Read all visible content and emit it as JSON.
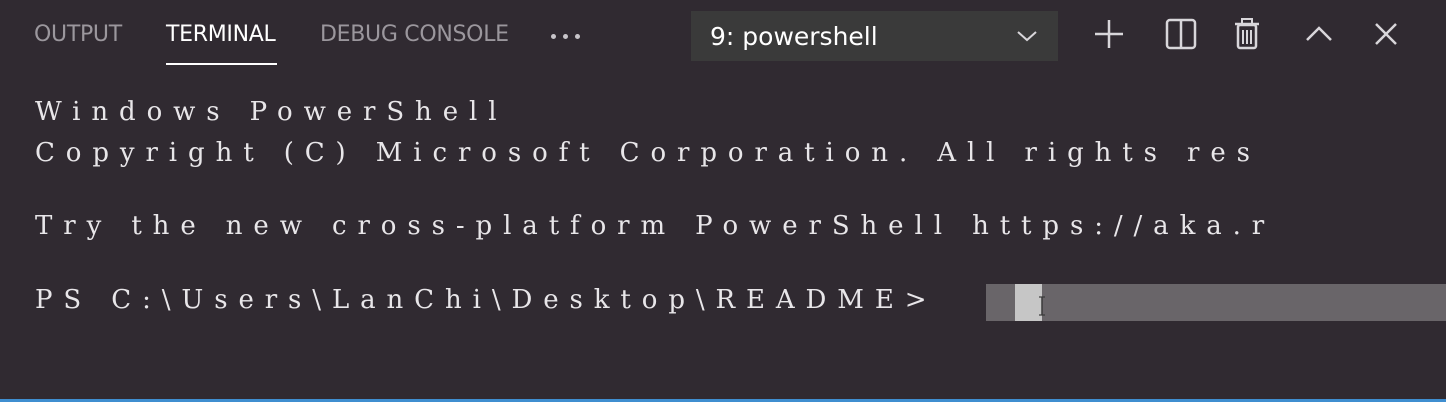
{
  "tabs": [
    {
      "label": "OUTPUT",
      "active": false
    },
    {
      "label": "TERMINAL",
      "active": true
    },
    {
      "label": "DEBUG CONSOLE",
      "active": false
    }
  ],
  "more_icon": "ellipsis-icon",
  "terminal_select": {
    "value": "9: powershell",
    "icon": "chevron-down-icon"
  },
  "toolbar": {
    "new_icon": "plus-icon",
    "split_icon": "split-pane-icon",
    "kill_icon": "trash-icon",
    "maximize_icon": "chevron-up-icon",
    "close_icon": "close-icon"
  },
  "terminal": {
    "lines": [
      "Windows PowerShell",
      "Copyright (C) Microsoft Corporation. All rights res",
      "",
      "Try the new cross-platform PowerShell https://aka.r",
      "",
      "PS C:\\Users\\LanChi\\Desktop\\README>"
    ]
  },
  "colors": {
    "background": "#302a31",
    "active_tab": "#ffffff",
    "inactive_tab": "#9b979d",
    "select_bg": "#3a3a3a",
    "terminal_text": "#e8e6e9",
    "selection": "#696569",
    "cursor": "#c6c6c6",
    "status_accent": "#3f8ed0"
  }
}
